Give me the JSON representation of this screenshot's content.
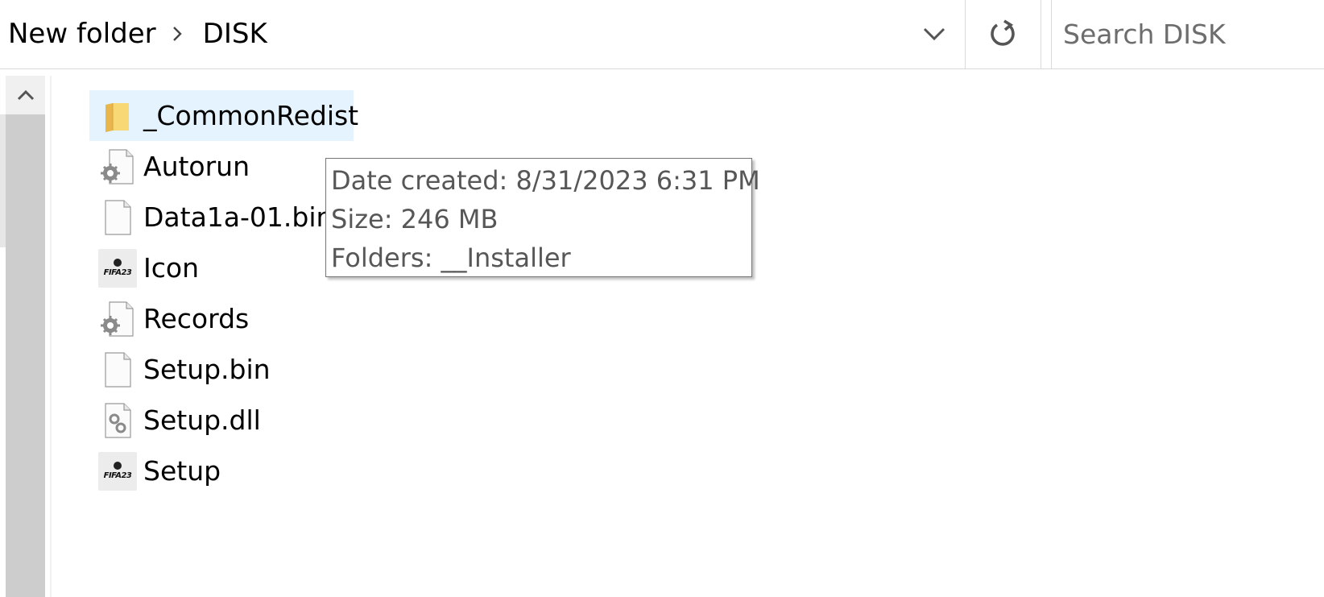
{
  "breadcrumb": {
    "items": [
      "New folder",
      "DISK"
    ]
  },
  "search": {
    "placeholder": "Search DISK"
  },
  "files": [
    {
      "name": "_CommonRedist",
      "icon": "folder-icon",
      "selected": true
    },
    {
      "name": "Autorun",
      "icon": "settings-file-icon"
    },
    {
      "name": "Data1a-01.bin",
      "icon": "blank-file-icon"
    },
    {
      "name": "Icon",
      "icon": "fifa23-icon"
    },
    {
      "name": "Records",
      "icon": "settings-file-icon"
    },
    {
      "name": "Setup.bin",
      "icon": "blank-file-icon"
    },
    {
      "name": "Setup.dll",
      "icon": "dll-file-icon"
    },
    {
      "name": "Setup",
      "icon": "fifa23-icon"
    }
  ],
  "tooltip": {
    "date_created": "Date created: 8/31/2023 6:31 PM",
    "size": "Size: 246 MB",
    "folders": "Folders: __Installer"
  },
  "icons": {
    "fifa_text": "FIFA23"
  },
  "colors": {
    "selection_bg": "#e5f3ff",
    "folder": "#f8d775",
    "scrollbar": "#cdcdcd"
  }
}
